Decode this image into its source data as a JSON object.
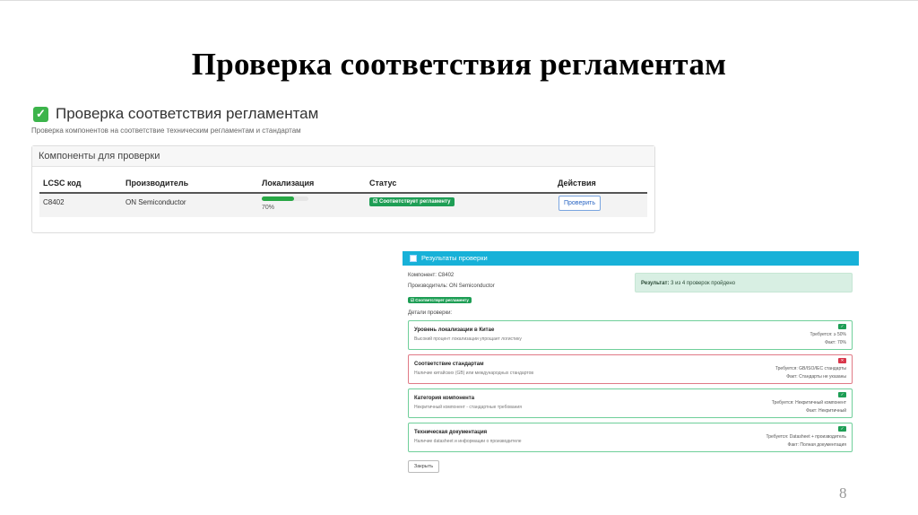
{
  "slide": {
    "title": "Проверка соответствия регламентам",
    "page_number": "8"
  },
  "compliance_page": {
    "title": "Проверка соответствия регламентам",
    "subtitle": "Проверка компонентов на соответствие техническим регламентам и стандартам",
    "card_title": "Компоненты для проверки",
    "columns": [
      "LCSC код",
      "Производитель",
      "Локализация",
      "Статус",
      "Действия"
    ],
    "row": {
      "lcsc": "C8402",
      "manufacturer": "ON Semiconductor",
      "localization_value": 0.7,
      "localization_label": "70%",
      "status": "Соответствует регламенту",
      "action": "Проверить"
    }
  },
  "results_modal": {
    "title": "Результаты проверки",
    "component": "Компонент: C8402",
    "manufacturer": "Производитель: ON Semiconductor",
    "badge": "Соответствует регламенту",
    "details_label": "Детали проверки:",
    "summary_label": "Результат:",
    "summary_text": "3 из 4 проверок пройдено",
    "checks": [
      {
        "title": "Уровень локализации в Китае",
        "desc": "Высокий процент локализации упрощает логистику",
        "required": "Требуется: ≥ 50%",
        "fact": "Факт: 70%",
        "status_icon": "✓",
        "passed": true
      },
      {
        "title": "Соответствие стандартам",
        "desc": "Наличие китайских (GB) или международных стандартов",
        "required": "Требуется: GB/ISO/IEC стандарты",
        "fact": "Факт: Стандарты не указаны",
        "status_icon": "✕",
        "passed": false
      },
      {
        "title": "Категория компонента",
        "desc": "Некритичный компонент - стандартные требования",
        "required": "Требуется: Некритичный компонент",
        "fact": "Факт: Некритичный",
        "status_icon": "✓",
        "passed": true
      },
      {
        "title": "Техническая документация",
        "desc": "Наличие datasheet и информации о производителе",
        "required": "Требуется: Datasheet + производитель",
        "fact": "Факт: Полная документация",
        "status_icon": "✓",
        "passed": true
      }
    ],
    "close_label": "Закрыть"
  },
  "colors": {
    "accent": "#17b1d8",
    "success": "#1e9e55",
    "danger": "#d9364a",
    "check_green": "#3cb44b"
  },
  "icons": {
    "header_check": "check-square-icon",
    "modal_header": "chart-icon"
  }
}
